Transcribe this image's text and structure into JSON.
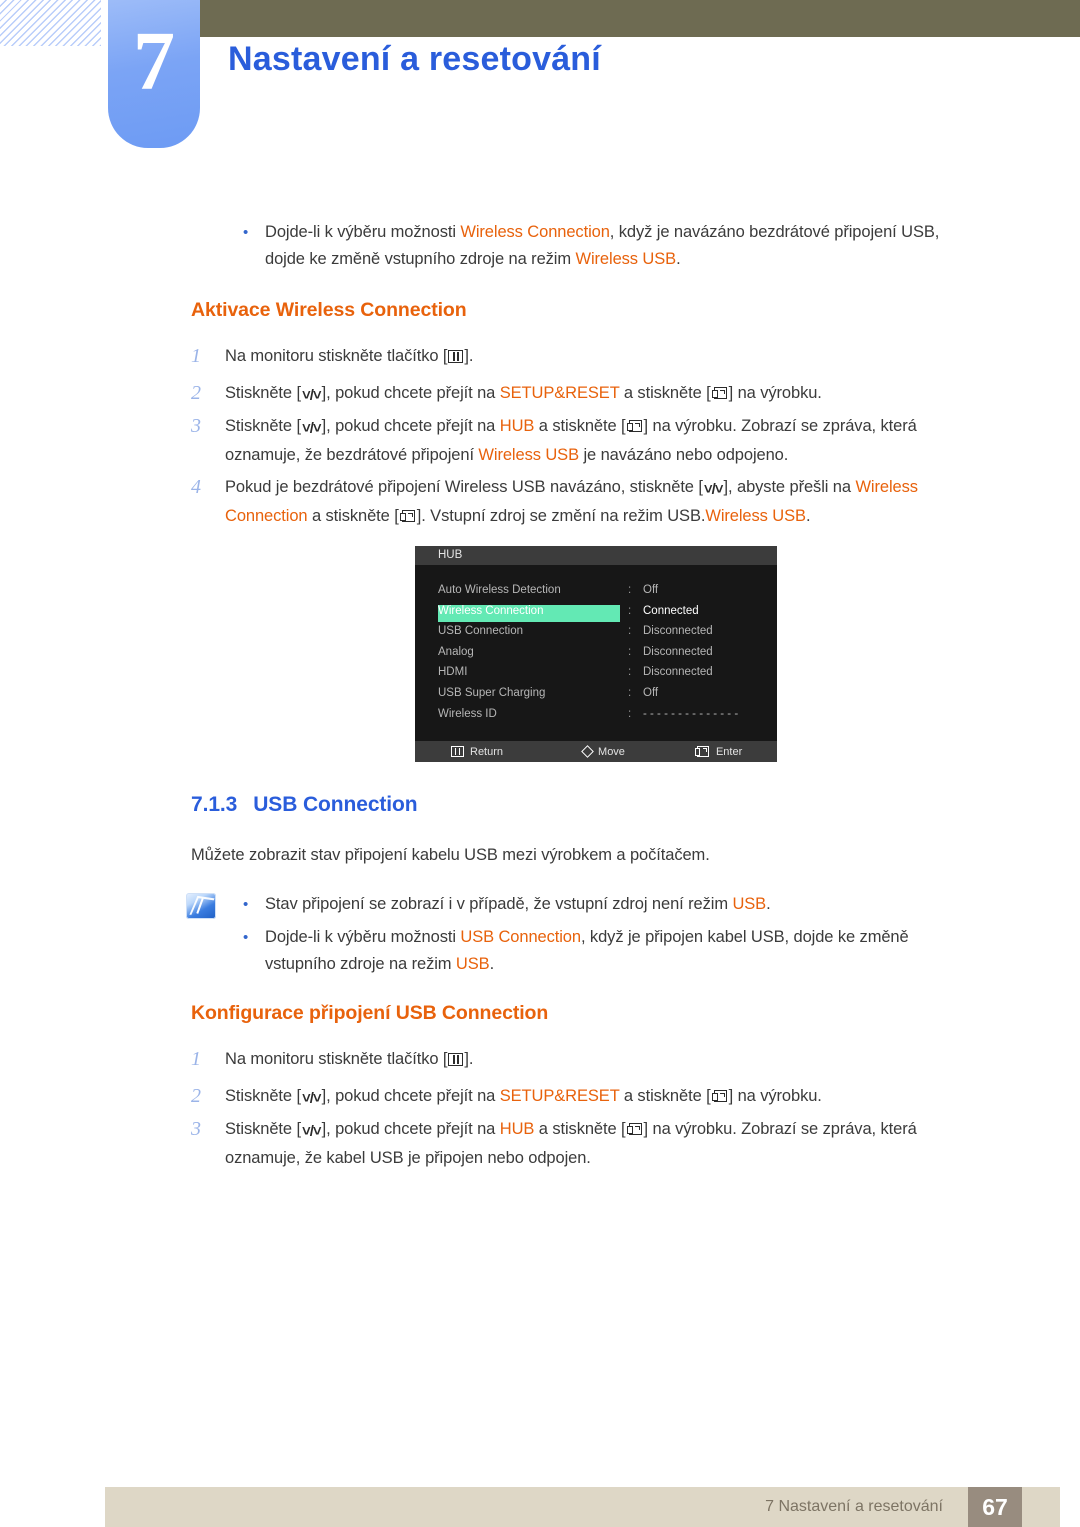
{
  "header": {
    "chapter_number": "7",
    "chapter_title": "Nastavení a resetování"
  },
  "intro_bullet": {
    "line1_a": "Dojde-li k výběru možnosti ",
    "line1_hl": "Wireless Connection",
    "line1_b": ", když je navázáno bezdrátové připojení USB,",
    "line2_a": "dojde ke změně vstupního zdroje na režim ",
    "line2_hl": "Wireless USB",
    "line2_b": "."
  },
  "section_a": {
    "heading": "Aktivace Wireless Connection",
    "steps": [
      {
        "num": "1",
        "parts": [
          "Na monitoru stiskněte tlačítko [",
          "MENU_ICON",
          "]."
        ]
      },
      {
        "num": "2",
        "pre": "Stiskněte [",
        "key1": "UPDOWN_ICON",
        "mid1": "], pokud chcete přejít na ",
        "hl1": "SETUP&RESET",
        "mid2": " a stiskněte [",
        "key2": "ENTER_ICON",
        "post": "] na výrobku."
      },
      {
        "num": "3",
        "pre": "Stiskněte [",
        "key1": "UPDOWN_ICON",
        "mid1": "], pokud chcete přejít na ",
        "hl1": "HUB",
        "mid2": " a stiskněte [",
        "key2": "ENTER_ICON",
        "post": "] na výrobku. Zobrazí se zpráva, která",
        "line2_a": "oznamuje, že bezdrátové připojení ",
        "line2_hl": "Wireless USB",
        "line2_b": " je navázáno nebo odpojeno."
      },
      {
        "num": "4",
        "pre": "Pokud je bezdrátové připojení Wireless USB navázáno, stiskněte [",
        "key1": "UPDOWN_ICON",
        "mid1": "], abyste přešli na ",
        "hl1": "Wireless",
        "line2_hl1": "Connection",
        "line2_mid": " a stiskněte [",
        "key2": "ENTER_ICON",
        "line2_post": "]. Vstupní zdroj se změní na režim USB.",
        "line2_hl2": "Wireless USB",
        "line2_end": "."
      }
    ]
  },
  "osd": {
    "title": "HUB",
    "rows": [
      {
        "label": "Auto Wireless Detection",
        "value": "Off",
        "selected": false
      },
      {
        "label": "Wireless Connection",
        "value": "Connected",
        "selected": true
      },
      {
        "label": "USB Connection",
        "value": "Disconnected",
        "selected": false
      },
      {
        "label": "Analog",
        "value": "Disconnected",
        "selected": false
      },
      {
        "label": "HDMI",
        "value": "Disconnected",
        "selected": false
      },
      {
        "label": "USB Super Charging",
        "value": "Off",
        "selected": false
      },
      {
        "label": "Wireless ID",
        "value": "- - - - - - - - - - - - - -",
        "selected": false
      }
    ],
    "colon": ":",
    "hints": {
      "return": "Return",
      "move": "Move",
      "enter": "Enter"
    },
    "highlight_color": "#63e9b4"
  },
  "section_b": {
    "number": "7.1.3",
    "title": "USB Connection",
    "paragraph": "Můžete zobrazit stav připojení kabelu USB mezi výrobkem a počítačem.",
    "notes": [
      {
        "a": "Stav připojení se zobrazí i v případě, že vstupní zdroj není režim ",
        "hl": "USB",
        "b": "."
      },
      {
        "a": "Dojde-li k výběru možnosti ",
        "hl": "USB Connection",
        "b": ", když je připojen kabel USB, dojde ke změně",
        "line2_a": "vstupního zdroje na režim ",
        "line2_hl": "USB",
        "line2_b": "."
      }
    ],
    "heading": "Konfigurace připojení USB Connection",
    "steps": [
      {
        "num": "1",
        "pre": "Na monitoru stiskněte tlačítko [",
        "key1": "MENU_ICON",
        "post": "]."
      },
      {
        "num": "2",
        "pre": "Stiskněte [",
        "key1": "UPDOWN_ICON",
        "mid1": "], pokud chcete přejít na ",
        "hl1": "SETUP&RESET",
        "mid2": " a stiskněte [",
        "key2": "ENTER_ICON",
        "post": "] na výrobku."
      },
      {
        "num": "3",
        "pre": "Stiskněte [",
        "key1": "UPDOWN_ICON",
        "mid1": "], pokud chcete přejít na ",
        "hl1": "HUB",
        "mid2": " a stiskněte [",
        "key2": "ENTER_ICON",
        "post": "] na výrobku. Zobrazí se zpráva, která",
        "line2": "oznamuje, že kabel USB je připojen nebo odpojen."
      }
    ]
  },
  "footer": {
    "text": "7 Nastavení a resetování",
    "page": "67"
  },
  "colors": {
    "accent_blue": "#2a5ddb",
    "accent_orange": "#e8620c",
    "olive": "#6e6b52",
    "footer_beige": "#ded7c6",
    "footer_page_box": "#988c7f"
  }
}
